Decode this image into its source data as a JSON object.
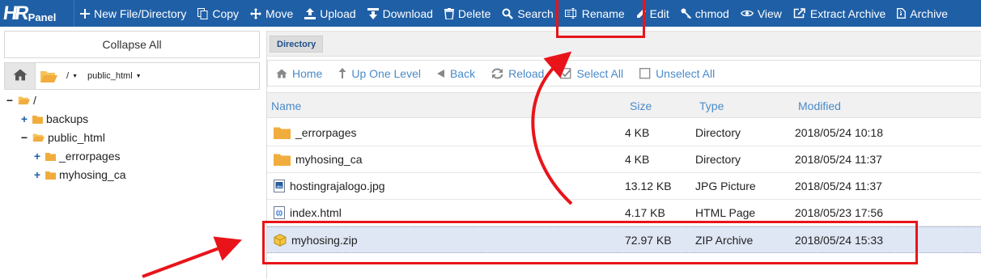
{
  "logo": {
    "mark": "HR",
    "text": "Panel"
  },
  "toolbar": {
    "items": [
      {
        "label": "New File/Directory",
        "icon": "plus-icon"
      },
      {
        "label": "Copy",
        "icon": "copy-icon"
      },
      {
        "label": "Move",
        "icon": "move-icon"
      },
      {
        "label": "Upload",
        "icon": "upload-icon"
      },
      {
        "label": "Download",
        "icon": "download-icon"
      },
      {
        "label": "Delete",
        "icon": "trash-icon"
      },
      {
        "label": "Search",
        "icon": "search-icon"
      },
      {
        "label": "Rename",
        "icon": "rename-icon"
      },
      {
        "label": "Edit",
        "icon": "pencil-icon"
      },
      {
        "label": "chmod",
        "icon": "key-icon"
      },
      {
        "label": "View",
        "icon": "eye-icon"
      },
      {
        "label": "Extract Archive",
        "icon": "extract-icon"
      },
      {
        "label": "Archive",
        "icon": "archive-icon"
      }
    ]
  },
  "sidebar": {
    "collapse_label": "Collapse All",
    "path": {
      "root": "/",
      "current": "public_html"
    },
    "tree": [
      {
        "label": "/",
        "expander": "−",
        "open": true
      },
      {
        "label": "backups",
        "expander": "+",
        "open": false
      },
      {
        "label": "public_html",
        "expander": "−",
        "open": true
      },
      {
        "label": "_errorpages",
        "expander": "+",
        "open": false
      },
      {
        "label": "myhosing_ca",
        "expander": "+",
        "open": false
      }
    ]
  },
  "main": {
    "tab_label": "Directory",
    "nav": [
      {
        "label": "Home",
        "icon": "home-icon"
      },
      {
        "label": "Up One Level",
        "icon": "arrow-up-icon"
      },
      {
        "label": "Back",
        "icon": "back-icon"
      },
      {
        "label": "Reload",
        "icon": "reload-icon"
      },
      {
        "label": "Select All",
        "icon": "checkbox-checked-icon"
      },
      {
        "label": "Unselect All",
        "icon": "checkbox-empty-icon"
      }
    ],
    "columns": {
      "name": "Name",
      "size": "Size",
      "type": "Type",
      "modified": "Modified"
    },
    "files": [
      {
        "name": "_errorpages",
        "size": "4 KB",
        "type": "Directory",
        "modified": "2018/05/24 10:18",
        "icon": "folder-icon",
        "selected": false
      },
      {
        "name": "myhosing_ca",
        "size": "4 KB",
        "type": "Directory",
        "modified": "2018/05/24 11:37",
        "icon": "folder-icon",
        "selected": false
      },
      {
        "name": "hostingrajalogo.jpg",
        "size": "13.12 KB",
        "type": "JPG Picture",
        "modified": "2018/05/24 11:37",
        "icon": "image-file-icon",
        "selected": false
      },
      {
        "name": "index.html",
        "size": "4.17 KB",
        "type": "HTML Page",
        "modified": "2018/05/23 17:56",
        "icon": "html-file-icon",
        "selected": false
      },
      {
        "name": "myhosing.zip",
        "size": "72.97 KB",
        "type": "ZIP Archive",
        "modified": "2018/05/24 15:33",
        "icon": "zip-file-icon",
        "selected": true
      }
    ]
  },
  "colors": {
    "toolbar_bg": "#1f5fa6",
    "link": "#4a8ac9",
    "selected_row": "#dfe6f4",
    "annotation": "#e8141a",
    "folder": "#f0ad3e"
  }
}
